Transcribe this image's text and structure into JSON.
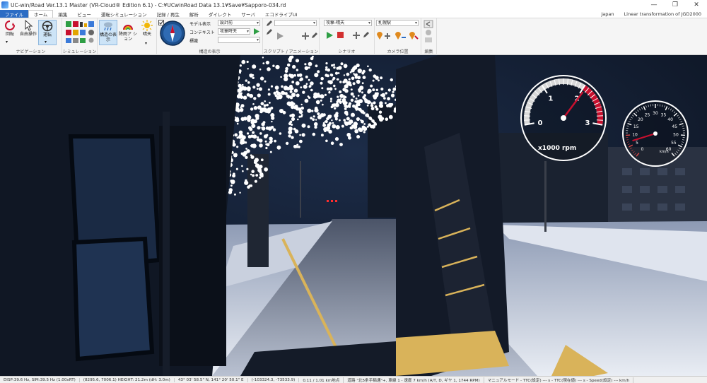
{
  "window": {
    "title": "UC-win/Road Ver.13.1 Master (VR-Cloud® Edition 6.1) - C:¥UCwinRoad Data 13.1¥Save¥Sapporo-034.rd",
    "minimize": "—",
    "maximize": "❐",
    "close": "✕"
  },
  "menu": {
    "file": "ファイル",
    "tabs": [
      "ホーム",
      "編集",
      "ビュー",
      "運転シミュレーション",
      "記録 / 再生",
      "解析",
      "ダ゙イレクト",
      "サーバ",
      "エコドライブUI"
    ],
    "region": "Japan",
    "projection": "Linear transformation of JGD2000"
  },
  "ribbon": {
    "navigation": {
      "label": "ナビゲーション",
      "rotate": "回転",
      "free": "自由操作",
      "drive": "運転"
    },
    "simulation": {
      "label": "シミュレーション"
    },
    "weather": {
      "scene_display": "構造の表示",
      "rain_snow": "降雨ア ション",
      "sunny": "晴天"
    },
    "scene_display": {
      "label": "構造の表示",
      "model_label": "モデル表示",
      "model_value": "設計前",
      "context_label": "コンテキスト",
      "context_value": "攻撃時天",
      "sign_label": "標識",
      "sign_value": ""
    },
    "script": {
      "label": "スクリプト / アニメーション",
      "value": ""
    },
    "scenario": {
      "label": "シナリオ",
      "value": "攻撃-晴天"
    },
    "camera": {
      "label": "カメラ位置",
      "value": "札幌駅"
    },
    "edit": {
      "label": "編集"
    }
  },
  "gauges": {
    "tach": {
      "unit": "x1000 rpm",
      "ticks": [
        "0",
        "1",
        "2",
        "3"
      ],
      "max": 3,
      "value": 2.05
    },
    "speed": {
      "unit": "km/h",
      "ticks": [
        "0",
        "5",
        "10",
        "15",
        "20",
        "25",
        "30",
        "35",
        "40",
        "45",
        "50",
        "55",
        "60"
      ],
      "max": 60,
      "value": 7
    }
  },
  "status": {
    "disp": "DISP:39.6 Hz, SIM:39.5 Hz (1.00xRT)",
    "coords": "(8295.6, 7006.1)  HEIGHT: 21.2m (dH: 3.0m)",
    "latlon": "43° 03' 58.5\" N, 141° 20' 50.1\" E",
    "xy": "(-103324.3, -73533.9)",
    "distance": "0.11 / 1.01 km地点",
    "road": "道路 \"北5条手稲通\"+, 車線 1 - 速度 7 km/h (A/T, D, ギヤ 1, 1744 RPM)",
    "mode": "マニュアルモード - TTC(設定) --- s - TTC(現在値) --- s - Speed(設定) --- km/h"
  },
  "colors": {
    "accent": "#2b6cc4",
    "gauge_red": "#c8102e",
    "night_sky": "#0e1522",
    "snow": "#e8ecf4",
    "plow_yellow": "#d9b35a"
  }
}
